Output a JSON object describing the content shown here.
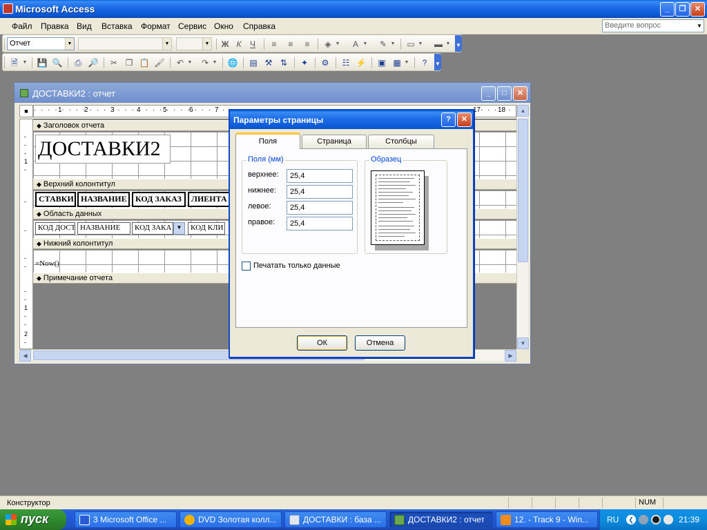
{
  "app": {
    "title": "Microsoft Access",
    "minimize": "_",
    "restore": "❐",
    "close": "✕"
  },
  "menu": {
    "items": [
      "Файл",
      "Правка",
      "Вид",
      "Вставка",
      "Формат",
      "Сервис",
      "Окно",
      "Справка"
    ],
    "ask_placeholder": "Введите вопрос"
  },
  "toolbar_format": {
    "object_combo": "Отчет",
    "font_combo": "",
    "size_combo": "",
    "bold": "Ж",
    "italic": "К",
    "underline": "Ч"
  },
  "report_window": {
    "title": "ДОСТАВКИ2 : отчет",
    "ruler_h": [
      "1",
      "2",
      "3",
      "4",
      "5",
      "6",
      "7",
      "17",
      "18"
    ],
    "ruler_v_header": [
      "1"
    ],
    "ruler_v_bottom": [
      "1",
      "2"
    ],
    "sections": {
      "report_header": "Заголовок отчета",
      "page_header": "Верхний колонтитул",
      "detail": "Область данных",
      "page_footer": "Нижний колонтитул",
      "report_footer": "Примечание отчета"
    },
    "title_label": "ДОСТАВКИ2",
    "page_header_labels": [
      "СТАВКИ",
      "НАЗВАНИЕ",
      "КОД ЗАКАЗ",
      "ЛИЕНТА"
    ],
    "detail_fields": [
      "КОД ДОСТ",
      "НАЗВАНИЕ",
      "КОД ЗАКА",
      "КОД КЛИ"
    ],
    "footer_expression": "=Now()"
  },
  "dialog": {
    "title": "Параметры страницы",
    "help": "?",
    "close": "✕",
    "tabs": [
      "Поля",
      "Страница",
      "Столбцы"
    ],
    "margins_group": "Поля (мм)",
    "fields": [
      {
        "label": "верхнее:",
        "value": "25,4"
      },
      {
        "label": "нижнее:",
        "value": "25,4"
      },
      {
        "label": "левое:",
        "value": "25,4"
      },
      {
        "label": "правое:",
        "value": "25,4"
      }
    ],
    "preview_group": "Образец",
    "print_data_only": "Печатать только данные",
    "ok": "ОК",
    "cancel": "Отмена"
  },
  "statusbar": {
    "mode": "Конструктор",
    "num": "NUM"
  },
  "taskbar": {
    "start": "пуск",
    "items": [
      "3 Microsoft Office ...",
      "DVD  Золотая колл...",
      "ДОСТАВКИ : база ...",
      "ДОСТАВКИ2 : отчет",
      "12.  - Track 9 - Win..."
    ],
    "lang": "RU",
    "clock": "21:39"
  },
  "colors": {
    "xp_blue": "#0a5fd8",
    "face": "#ece9d8",
    "start_green": "#2f8a2f",
    "tab_accent": "#ffc83c"
  }
}
